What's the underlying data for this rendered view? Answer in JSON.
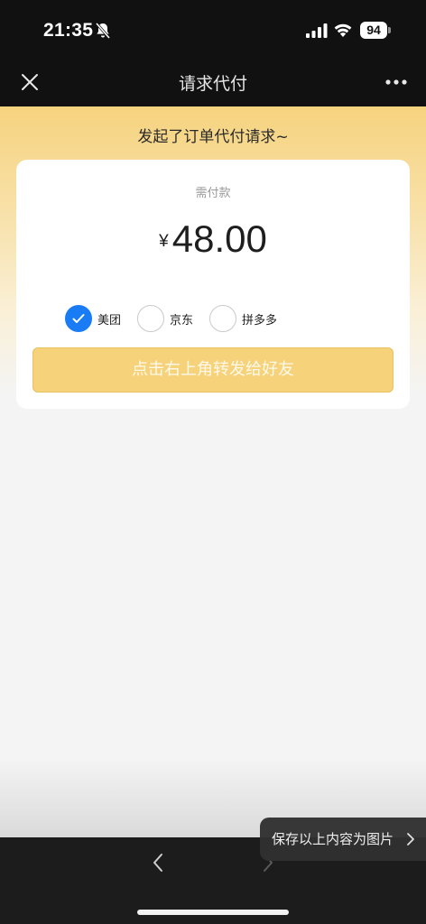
{
  "status_bar": {
    "time": "21:35",
    "battery": "94",
    "icons": [
      "bell-off-icon",
      "signal-icon",
      "wifi-icon",
      "battery-icon"
    ]
  },
  "nav": {
    "title": "请求代付",
    "close_icon": "close-icon",
    "more_icon": "more-icon"
  },
  "hero": {
    "text": "发起了订单代付请求~"
  },
  "card": {
    "amount_label": "需付款",
    "currency": "¥",
    "amount": "48.00",
    "platforms": [
      {
        "label": "美团",
        "checked": true
      },
      {
        "label": "京东",
        "checked": false
      },
      {
        "label": "拼多多",
        "checked": false
      }
    ],
    "button_label": "点击右上角转发给好友"
  },
  "toast": {
    "label": "保存以上内容为图片"
  },
  "colors": {
    "accent_blue": "#1a7cf5",
    "button_yellow": "#f6d27a",
    "header_gradient_top": "#f6d37e"
  }
}
